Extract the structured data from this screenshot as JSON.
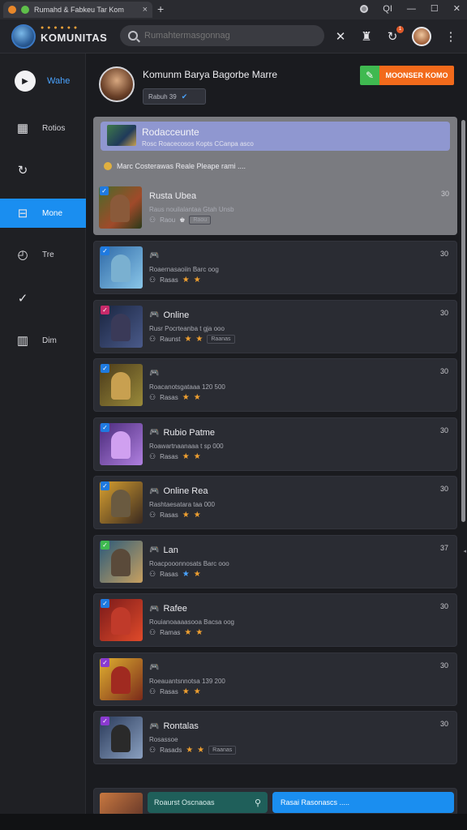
{
  "browser": {
    "tab_title": "Rumahd & Fabkeu Tar Kom",
    "new_tab": "+",
    "close_tab": "×",
    "controls": [
      "QI",
      "—",
      "☐",
      "✕"
    ]
  },
  "header": {
    "brand_tagline": "● ● ● ● ● ●",
    "brand": "KOMUNITAS",
    "search_placeholder": "Rumahtermasgonnag",
    "notif_count": "1"
  },
  "sidebar": {
    "items": [
      {
        "label": "Wahe",
        "icon": "▶"
      },
      {
        "label": "Rotios",
        "icon": "▦"
      },
      {
        "label": "",
        "icon": "↻"
      },
      {
        "label": "Mone",
        "icon": "⊟"
      },
      {
        "label": "Tre",
        "icon": "◴"
      },
      {
        "label": "",
        "icon": "✓"
      },
      {
        "label": "Dim",
        "icon": "▥"
      }
    ]
  },
  "profile": {
    "name": "Komunm Barya Bagorbe Marre",
    "pill": "Rabuh 39",
    "promo_label": "MOONSER KOMO"
  },
  "featured": {
    "banner_title": "Rodacceunte",
    "banner_sub": "Rosc Roacecosos Kopts CCanpa asco",
    "notice": "Marc Costerawas Reale Pleape rami ....",
    "post_title": "Rusta Ubea",
    "post_desc": "Raus nouilalantaa Gtah Unsb",
    "post_meta": "Raou",
    "post_tag": "Raou",
    "post_num": "30"
  },
  "cards": [
    {
      "title": "",
      "desc": "Roaernasaoiin Barc oog",
      "meta": "Rasas",
      "tag": "",
      "num": "30",
      "badge": "#1f7ae0",
      "bg": [
        "#2f6aa8",
        "#8ac6e8"
      ],
      "fig": "#7ab0d0"
    },
    {
      "title": "Online",
      "desc": "Rusr Pocrteanba t gja ooo",
      "meta": "Raunst",
      "tag": "Raanas",
      "num": "30",
      "badge": "#c82a6a",
      "bg": [
        "#1a2540",
        "#4a5a8a"
      ],
      "fig": "#3a3a58"
    },
    {
      "title": "",
      "desc": "Roacanotsgataaa 120 500",
      "meta": "Rasas",
      "tag": "",
      "num": "30",
      "badge": "#1f7ae0",
      "bg": [
        "#4a3a1a",
        "#9a8a3a"
      ],
      "fig": "#c8a050"
    },
    {
      "title": "Rubio Patme",
      "desc": "Roawartnaanaaa t sp 000",
      "meta": "Rasas",
      "tag": "",
      "num": "30",
      "badge": "#1f7ae0",
      "bg": [
        "#4a2a7a",
        "#b080e0"
      ],
      "fig": "#d0a0f0"
    },
    {
      "title": "Online Rea",
      "desc": "Rashtaesatara taa 000",
      "meta": "Rasas",
      "tag": "",
      "num": "30",
      "badge": "#1f7ae0",
      "bg": [
        "#d8a030",
        "#3a2a20"
      ],
      "fig": "#6a5a40"
    },
    {
      "title": "Lan",
      "desc": "Roacpooonnosats Barc ooo",
      "meta": "Rasas",
      "tag": "",
      "num": "37",
      "badge": "#3fb950",
      "bg": [
        "#2a5a7a",
        "#c8a060"
      ],
      "fig": "#5a4a3a"
    },
    {
      "title": "Rafee",
      "desc": "Rouianoaaaasooa Bacsa oog",
      "meta": "Ramas",
      "tag": "",
      "num": "30",
      "badge": "#1f7ae0",
      "bg": [
        "#7a1a1a",
        "#e04a2a"
      ],
      "fig": "#c03a2a"
    },
    {
      "title": "",
      "desc": "Roeauantsnnotsa 139 200",
      "meta": "Rasas",
      "tag": "",
      "num": "30",
      "badge": "#8a3ad0",
      "bg": [
        "#e0b030",
        "#7a2a1a"
      ],
      "fig": "#a02a20"
    },
    {
      "title": "Rontalas",
      "desc": "Rosassoe",
      "meta": "Rasads",
      "tag": "Raanas",
      "num": "30",
      "badge": "#8a3ad0",
      "bg": [
        "#2a3a5a",
        "#8aa0c0"
      ],
      "fig": "#2a2a2a"
    }
  ],
  "bottom": {
    "field_text": "Roaurst Oscnaoas",
    "button_text": "Rasai Rasonascs ....."
  },
  "colors": {
    "accent": "#1a8ef0",
    "promo_orange": "#f26a1b",
    "promo_green": "#3fb950",
    "star": "#f0a030"
  }
}
